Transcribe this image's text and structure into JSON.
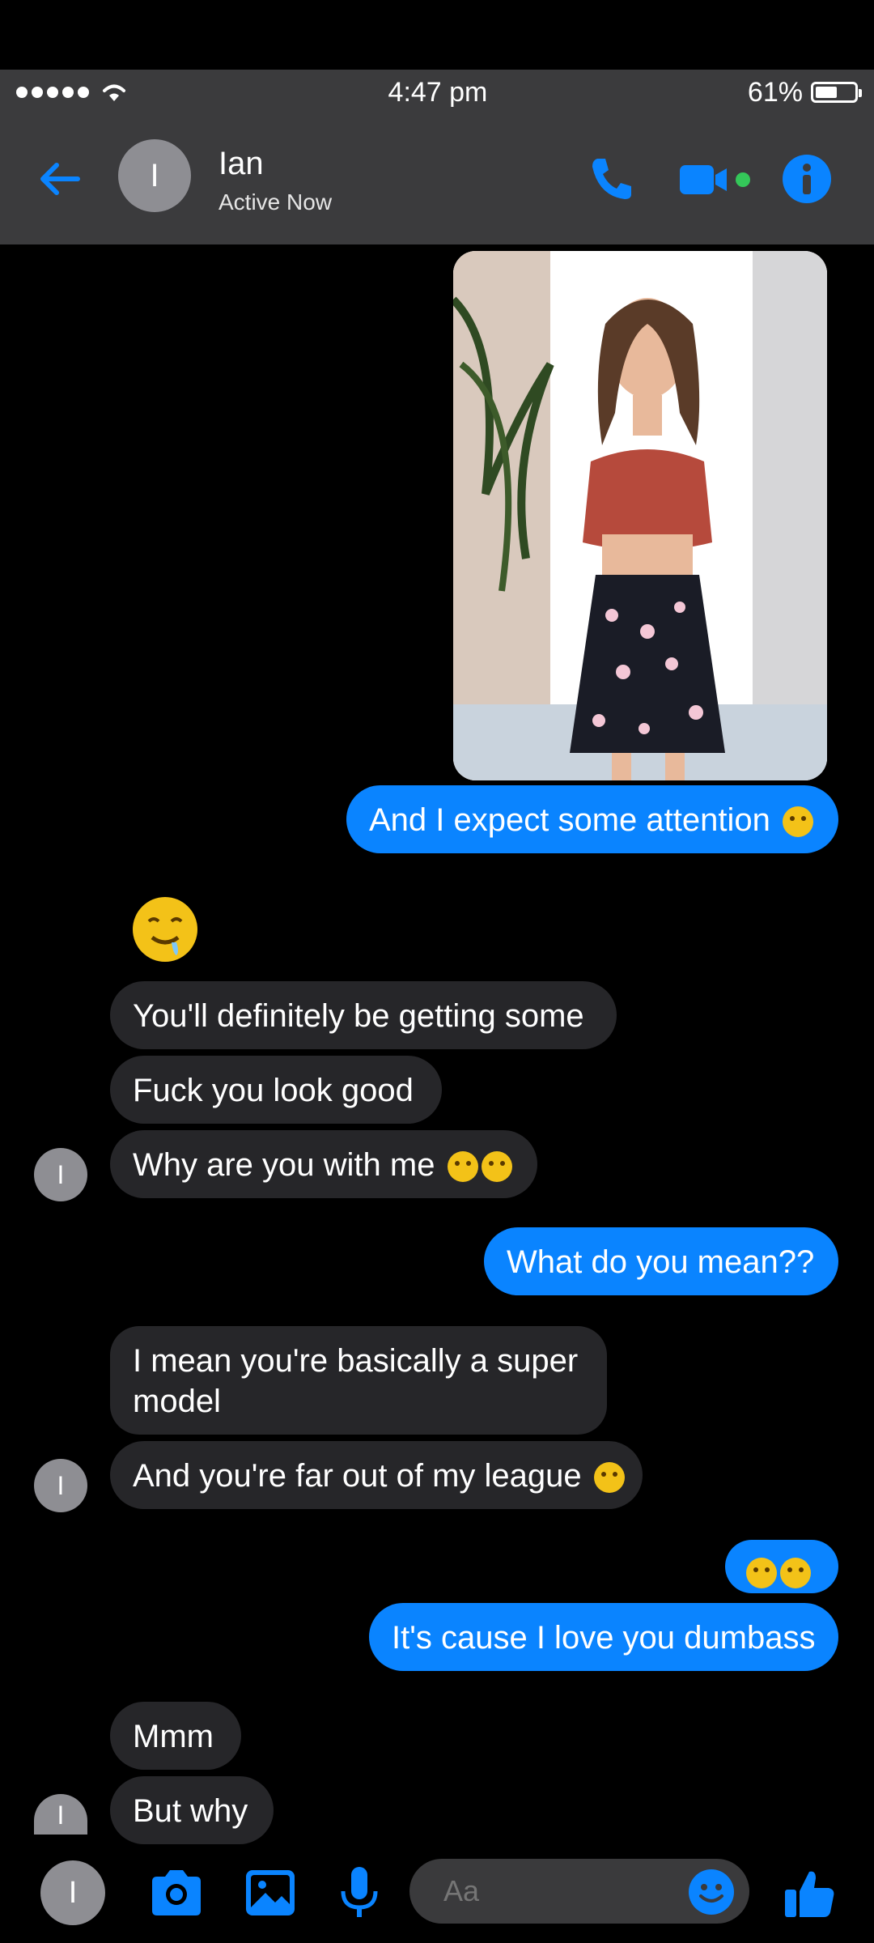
{
  "status_bar": {
    "time": "4:47 pm",
    "battery_percent": "61%",
    "battery_level": 0.61
  },
  "header": {
    "avatar_initial": "I",
    "contact_name": "Ian",
    "contact_status": "Active Now"
  },
  "colors": {
    "accent": "#0a84ff",
    "incoming_bubble": "#262629",
    "header_bg": "#3b3b3d",
    "online_dot": "#34c759"
  },
  "messages": [
    {
      "from": "me",
      "type": "image",
      "alt": "photo"
    },
    {
      "from": "me",
      "text": "And I expect some attention",
      "emoji": "winking-face"
    },
    {
      "from": "them",
      "type": "emoji",
      "emoji": "drooling-face"
    },
    {
      "from": "them",
      "text": "You'll definitely be getting some"
    },
    {
      "from": "them",
      "text": "Fuck you look good"
    },
    {
      "from": "them",
      "text": "Why are you with me",
      "emoji": "rolling-on-floor-laughing x2"
    },
    {
      "from": "me",
      "text": "What do you mean??"
    },
    {
      "from": "them",
      "text_line1": "I mean you're basically a super",
      "text_line2": "model"
    },
    {
      "from": "them",
      "text": "And you're far out of my league",
      "emoji": "rolling-on-floor-laughing"
    },
    {
      "from": "me",
      "type": "emoji",
      "emoji": "rolling-on-floor-laughing x2"
    },
    {
      "from": "me",
      "text": "It's cause I love you dumbass"
    },
    {
      "from": "them",
      "text": "Mmm"
    },
    {
      "from": "them",
      "text": "But why"
    }
  ],
  "composer": {
    "avatar_initial": "I",
    "placeholder": "Aa"
  },
  "icons": [
    "back-arrow-icon",
    "phone-icon",
    "video-camera-icon",
    "info-icon",
    "camera-icon",
    "photo-gallery-icon",
    "microphone-icon",
    "smile-icon",
    "thumbs-up-icon"
  ]
}
